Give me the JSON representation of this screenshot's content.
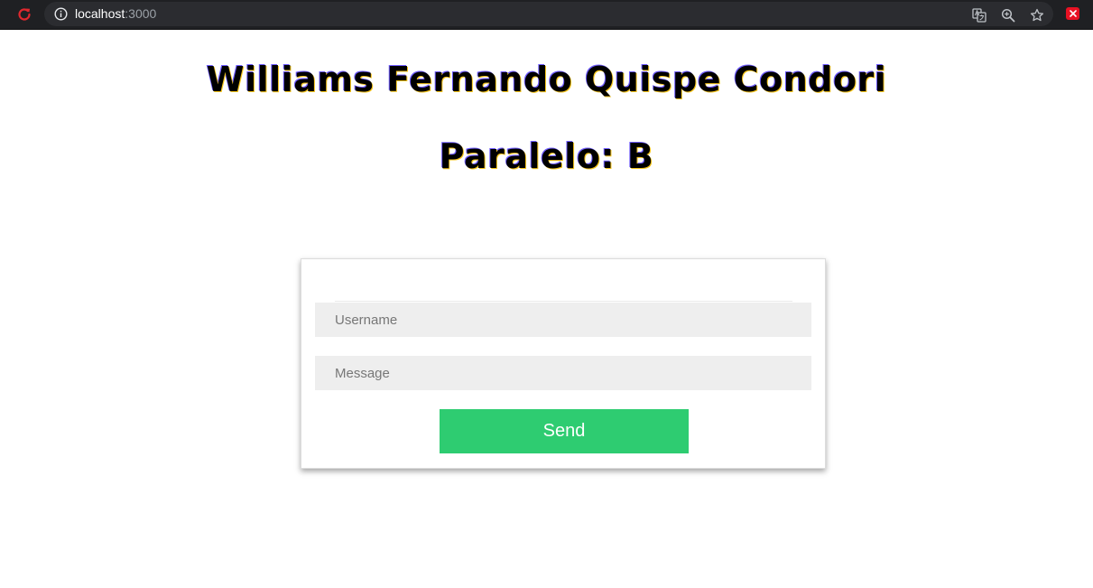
{
  "browser": {
    "url_host": "localhost",
    "url_port": ":3000",
    "icons": [
      "reload-icon",
      "site-info-icon",
      "translate-icon",
      "zoom-icon",
      "bookmark-star-icon",
      "close-icon"
    ],
    "colors": {
      "reload": "#e0282e",
      "close": "#e81123"
    }
  },
  "page": {
    "title": "Williams Fernando Quispe Condori",
    "subtitle": "Paralelo: B"
  },
  "form": {
    "username_placeholder": "Username",
    "message_placeholder": "Message",
    "send_label": "Send",
    "colors": {
      "send_button": "#2ecc71",
      "input_bg": "#eeeeee"
    }
  }
}
